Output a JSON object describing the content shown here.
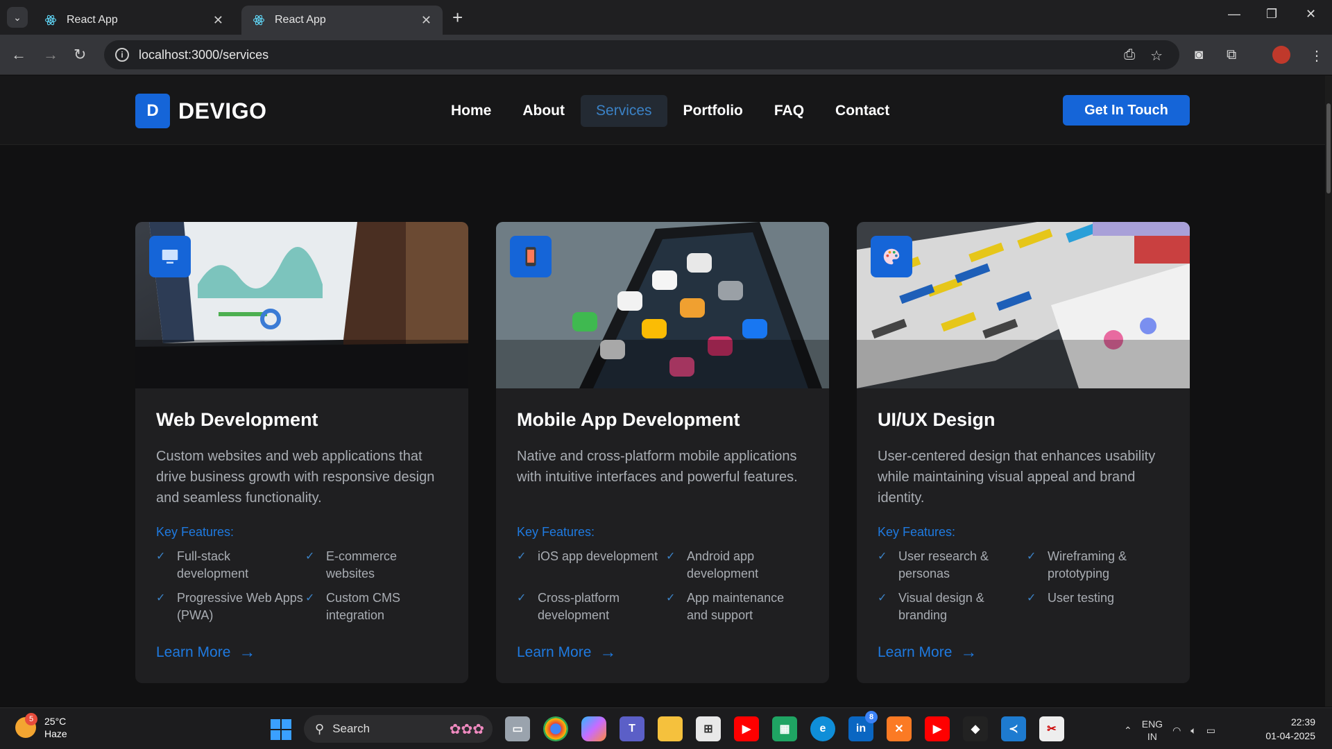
{
  "browser": {
    "tabs": [
      {
        "title": "React App",
        "active": false
      },
      {
        "title": "React App",
        "active": true
      }
    ],
    "url": "localhost:3000/services"
  },
  "site": {
    "logo_letter": "D",
    "brand": "DEVIGO",
    "nav": [
      "Home",
      "About",
      "Services",
      "Portfolio",
      "FAQ",
      "Contact"
    ],
    "active_nav": "Services",
    "cta": "Get In Touch",
    "accent": "#1565d8"
  },
  "cards": [
    {
      "title": "Web Development",
      "icon": "monitor-icon",
      "description": "Custom websites and web applications that drive business growth with responsive design and seamless functionality.",
      "features_label": "Key Features:",
      "features": [
        "Full-stack development",
        "E-commerce websites",
        "Progressive Web Apps (PWA)",
        "Custom CMS integration"
      ],
      "link": "Learn More"
    },
    {
      "title": "Mobile App Development",
      "icon": "mobile-icon",
      "description": "Native and cross-platform mobile applications with intuitive interfaces and powerful features.",
      "features_label": "Key Features:",
      "features": [
        "iOS app development",
        "Android app development",
        "Cross-platform development",
        "App maintenance and support"
      ],
      "link": "Learn More"
    },
    {
      "title": "UI/UX Design",
      "icon": "palette-icon",
      "description": "User-centered design that enhances usability while maintaining visual appeal and brand identity.",
      "features_label": "Key Features:",
      "features": [
        "User research & personas",
        "Wireframing & prototyping",
        "Visual design & branding",
        "User testing"
      ],
      "link": "Learn More"
    }
  ],
  "taskbar": {
    "weather_temp": "25°C",
    "weather_desc": "Haze",
    "weather_badge": "5",
    "search": "Search",
    "lang_top": "ENG",
    "lang_bottom": "IN",
    "time": "22:39",
    "date": "01-04-2025",
    "linkedin_badge": "8"
  }
}
